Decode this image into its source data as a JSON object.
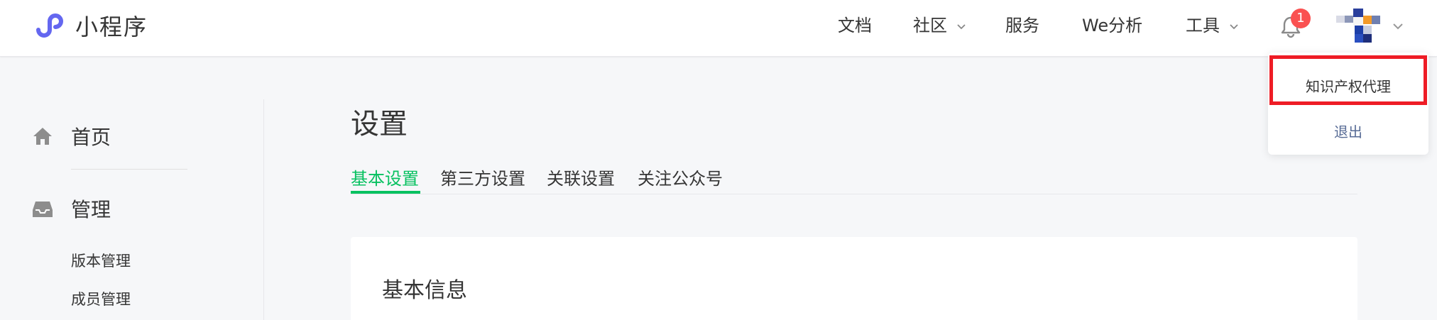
{
  "header": {
    "app_name": "小程序",
    "nav": [
      {
        "label": "文档"
      },
      {
        "label": "社区"
      },
      {
        "label": "服务"
      },
      {
        "label": "We分析"
      },
      {
        "label": "工具"
      }
    ],
    "notification_count": "1",
    "icons": {
      "logo": "miniprogram-logo-icon",
      "bell": "bell-icon",
      "avatar": "avatar-icon",
      "chevron": "chevron-down-icon"
    }
  },
  "dropdown": {
    "account_name": "知识产权代理",
    "logout_label": "退出"
  },
  "sidebar": {
    "items": [
      {
        "label": "首页",
        "icon": "home-icon"
      },
      {
        "label": "管理",
        "icon": "inbox-icon"
      }
    ],
    "sub_items": [
      {
        "label": "版本管理"
      },
      {
        "label": "成员管理"
      }
    ]
  },
  "main": {
    "title": "设置",
    "tabs": [
      {
        "label": "基本设置"
      },
      {
        "label": "第三方设置"
      },
      {
        "label": "关联设置"
      },
      {
        "label": "关注公众号"
      }
    ],
    "card_title": "基本信息"
  },
  "colors": {
    "accent_green": "#07c160",
    "logo_purple": "#6467f0",
    "badge_red": "#fa5151",
    "link_blue": "#576b95",
    "highlight_red": "#ee1c25"
  }
}
